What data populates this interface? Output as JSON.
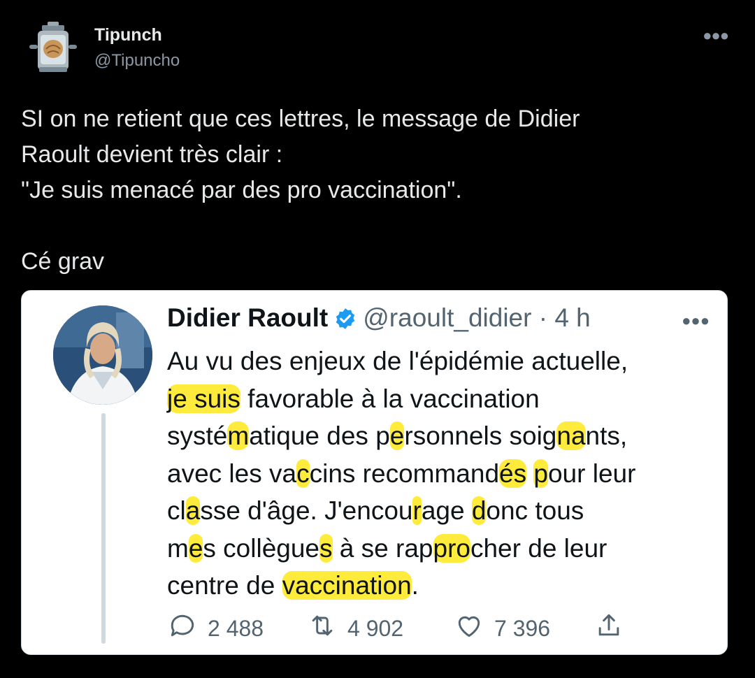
{
  "tweet": {
    "author_name": "Tipunch",
    "author_handle": "@Tipuncho",
    "more_icon": "more-horizontal-icon",
    "body": "SI on ne retient que ces lettres, le message de Didier\nRaoult devient très clair :\n\"Je suis menacé par des pro vaccination\".\n\nCé grav"
  },
  "quote": {
    "author_name": "Didier Raoult",
    "verified_icon": "verified-badge-icon",
    "author_handle": "@raoult_didier",
    "separator": "·",
    "time": "4 h",
    "more_icon": "more-horizontal-icon",
    "text_segments": [
      {
        "t": "Au vu des enjeux de l'épidémie actuelle,\n",
        "hl": false
      },
      {
        "t": "je suis",
        "hl": true
      },
      {
        "t": " favorable à la vaccination\nsysté",
        "hl": false
      },
      {
        "t": "m",
        "hl": true
      },
      {
        "t": "atique des p",
        "hl": false
      },
      {
        "t": "e",
        "hl": true
      },
      {
        "t": "rsonnels soig",
        "hl": false
      },
      {
        "t": "na",
        "hl": true
      },
      {
        "t": "nts,\navec les va",
        "hl": false
      },
      {
        "t": "c",
        "hl": true
      },
      {
        "t": "cins recommand",
        "hl": false
      },
      {
        "t": "és",
        "hl": true
      },
      {
        "t": " ",
        "hl": false
      },
      {
        "t": "p",
        "hl": true
      },
      {
        "t": "our leur\ncl",
        "hl": false
      },
      {
        "t": "a",
        "hl": true
      },
      {
        "t": "sse d'âge. J'encou",
        "hl": false
      },
      {
        "t": "r",
        "hl": true
      },
      {
        "t": "age ",
        "hl": false
      },
      {
        "t": "d",
        "hl": true
      },
      {
        "t": "onc tous\nm",
        "hl": false
      },
      {
        "t": "e",
        "hl": true
      },
      {
        "t": "s collègue",
        "hl": false
      },
      {
        "t": "s",
        "hl": true
      },
      {
        "t": " à se rap",
        "hl": false
      },
      {
        "t": "pro",
        "hl": true
      },
      {
        "t": "cher de leur\ncentre de ",
        "hl": false
      },
      {
        "t": "vaccination",
        "hl": true
      },
      {
        "t": ".",
        "hl": false
      }
    ],
    "actions": {
      "replies": "2 488",
      "retweets": "4 902",
      "likes": "7 396"
    },
    "icons": [
      "reply-icon",
      "retweet-icon",
      "like-icon",
      "share-icon"
    ],
    "colors": {
      "highlight": "#ffeb3b",
      "verified": "#1d9bf0"
    }
  }
}
